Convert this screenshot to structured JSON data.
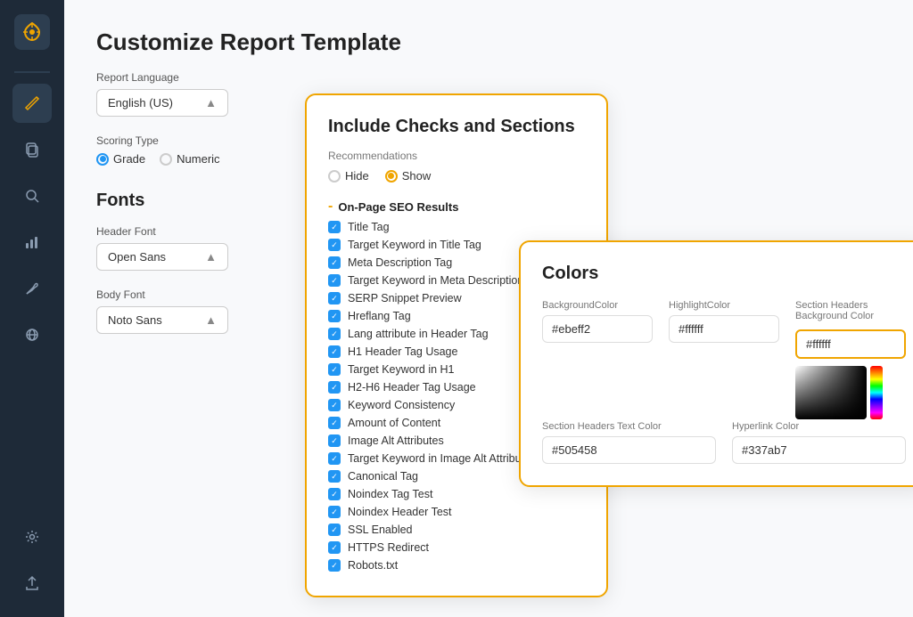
{
  "sidebar": {
    "logo_icon": "⟳",
    "items": [
      {
        "name": "edit",
        "icon": "✏",
        "active": true
      },
      {
        "name": "copy",
        "icon": "⧉",
        "active": false
      },
      {
        "name": "search",
        "icon": "⌕",
        "active": false
      },
      {
        "name": "chart",
        "icon": "▦",
        "active": false
      },
      {
        "name": "wrench",
        "icon": "⚙",
        "active": false
      },
      {
        "name": "globe",
        "icon": "⊕",
        "active": false
      },
      {
        "name": "settings",
        "icon": "⚙",
        "active": false
      },
      {
        "name": "upload",
        "icon": "↑",
        "active": false
      }
    ]
  },
  "page": {
    "title": "Customize Report Template"
  },
  "left_panel": {
    "report_language_label": "Report Language",
    "report_language_value": "English (US)",
    "scoring_type_label": "Scoring Type",
    "scoring_grade_label": "Grade",
    "scoring_numeric_label": "Numeric",
    "fonts_title": "Fonts",
    "header_font_label": "Header Font",
    "header_font_value": "Open Sans",
    "body_font_label": "Body Font",
    "body_font_value": "Noto Sans"
  },
  "checks_card": {
    "title": "Include Checks and Sections",
    "recommendations_label": "Recommendations",
    "hide_label": "Hide",
    "show_label": "Show",
    "section_header": "On-Page SEO Results",
    "items": [
      "Title Tag",
      "Target Keyword in Title Tag",
      "Meta Description Tag",
      "Target Keyword in Meta Description",
      "SERP Snippet Preview",
      "Hreflang Tag",
      "Lang attribute in Header Tag",
      "H1 Header Tag Usage",
      "Target Keyword in H1",
      "H2-H6 Header Tag Usage",
      "Keyword Consistency",
      "Amount of Content",
      "Image Alt Attributes",
      "Target Keyword in Image Alt Attributes",
      "Canonical Tag",
      "Noindex Tag Test",
      "Noindex Header Test",
      "SSL Enabled",
      "HTTPS Redirect",
      "Robots.txt"
    ]
  },
  "colors_card": {
    "title": "Colors",
    "bg_color_label": "BackgroundColor",
    "bg_color_value": "#ebeff2",
    "highlight_label": "HighlightColor",
    "highlight_value": "#ffffff",
    "section_headers_bg_label": "Section Headers Background Color",
    "section_headers_bg_value": "#ffffff",
    "section_headers_text_label": "Section Headers Text Color",
    "section_headers_text_value": "#505458",
    "hyperlink_label": "Hyperlink Color",
    "hyperlink_value": "#337ab7"
  }
}
